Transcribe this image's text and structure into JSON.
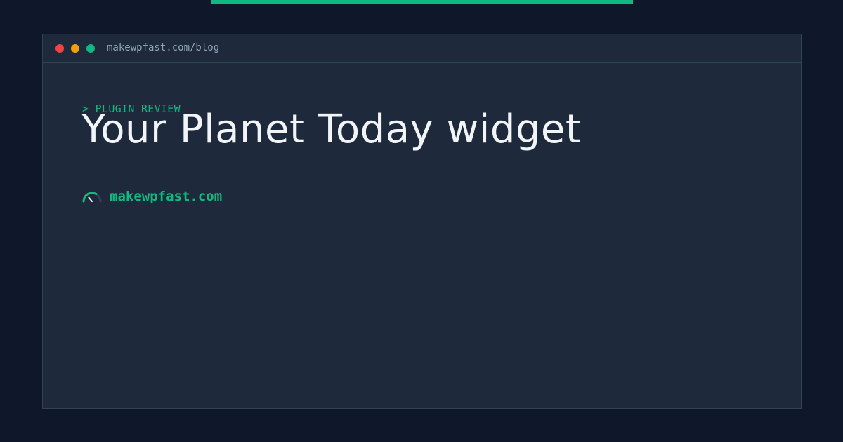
{
  "window": {
    "url": "makewpfast.com/blog"
  },
  "post": {
    "category": "> PLUGIN REVIEW",
    "title": "Your Planet Today widget"
  },
  "brand": {
    "name": "makewpfast.com",
    "icon": "speedometer-icon"
  },
  "colors": {
    "background": "#0f172a",
    "window": "#1e293b",
    "accent": "#10b981",
    "title": "#f1f5f9",
    "muted": "#94a3b8",
    "close": "#ef4444",
    "minimize": "#f59e0b",
    "maximize": "#10b981"
  }
}
